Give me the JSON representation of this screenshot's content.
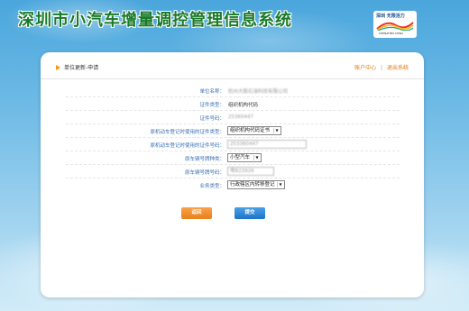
{
  "app": {
    "title": "深圳市小汽车增量调控管理信息系统"
  },
  "logo": {
    "text": "深圳 无限活力",
    "sub": "SHENZHEN CHINA"
  },
  "header": {
    "breadcrumb": "单位更新-申请",
    "links": {
      "account": "账户中心",
      "sep": "|",
      "logout": "退出系统"
    }
  },
  "form": {
    "fields": [
      {
        "label": "单位名称：",
        "value": "杭州大股石油科技有限公司",
        "type": "text-blurred"
      },
      {
        "label": "证件类型：",
        "value": "组织机构代码",
        "type": "text"
      },
      {
        "label": "证件号码：",
        "value": "25360447",
        "type": "text-blurred"
      },
      {
        "label": "原机动车登记时使用的证件类型：",
        "value": "组织机构代码证书",
        "type": "select"
      },
      {
        "label": "原机动车登记时使用的证件号码：",
        "value": "253360447",
        "type": "input"
      },
      {
        "label": "原车辆号牌种类：",
        "value": "小型汽车",
        "type": "select"
      },
      {
        "label": "原车辆号牌号码：",
        "value": "粤B23926",
        "type": "input"
      },
      {
        "label": "业务类型：",
        "value": "行政辖区内转移登记",
        "type": "select"
      }
    ]
  },
  "buttons": {
    "back": "返回",
    "submit": "提交"
  },
  "colors": {
    "accent": "#f39c12",
    "label": "#3a6fb0",
    "primary": "#1c74c8"
  }
}
